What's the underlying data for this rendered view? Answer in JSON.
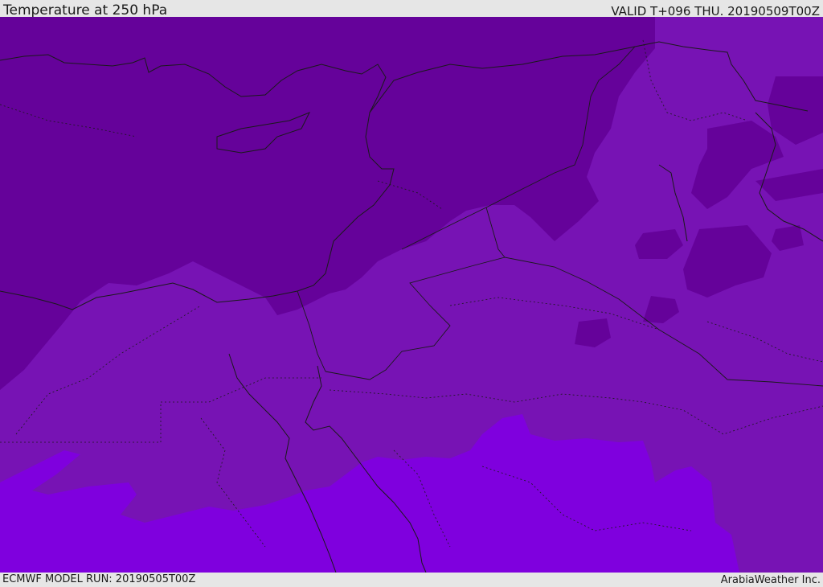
{
  "header": {
    "title": "Temperature at 250 hPa",
    "valid_time": "VALID T+096 THU. 20190509T00Z"
  },
  "footer": {
    "model_run": "ECMWF MODEL RUN: 20190505T00Z",
    "credit": "ArabiaWeather Inc."
  },
  "map": {
    "field": "temperature-250hPa",
    "colors": {
      "coldest": "#65029a",
      "cold": "#7713b4",
      "mild": "#7f00de",
      "borders": "#1a1a1a"
    }
  }
}
